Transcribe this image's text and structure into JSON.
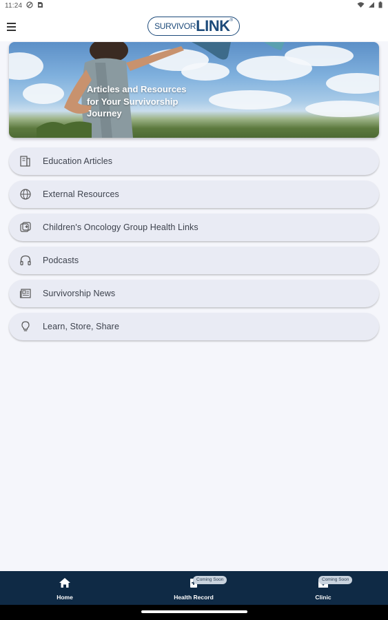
{
  "status_bar": {
    "time": "11:24",
    "left_icons": [
      "do-not-disturb-icon",
      "sim-card-icon"
    ],
    "right_icons": [
      "wifi-icon",
      "cell-signal-icon",
      "battery-icon"
    ]
  },
  "app_bar": {
    "menu_icon": "hamburger-menu-icon",
    "logo_text_small": "SURVIVOR",
    "logo_text_big": "LINK",
    "logo_tm": "®"
  },
  "hero": {
    "text": "Articles and Resources for Your Survivorship Journey"
  },
  "menu": {
    "items": [
      {
        "label": "Education Articles",
        "icon": "book-icon"
      },
      {
        "label": "External Resources",
        "icon": "globe-icon"
      },
      {
        "label": "Children's Oncology Group Health Links",
        "icon": "health-link-icon"
      },
      {
        "label": "Podcasts",
        "icon": "headphones-icon"
      },
      {
        "label": "Survivorship News",
        "icon": "newspaper-icon"
      },
      {
        "label": "Learn, Store, Share",
        "icon": "lightbulb-icon"
      }
    ]
  },
  "bottom_nav": {
    "items": [
      {
        "label": "Home",
        "icon": "home-icon",
        "badge": ""
      },
      {
        "label": "Health Record",
        "icon": "health-record-icon",
        "badge": "Coming Soon"
      },
      {
        "label": "Clinic",
        "icon": "clinic-icon",
        "badge": "Coming Soon"
      }
    ],
    "background_color": "#0f2a45"
  },
  "colors": {
    "accent": "#1c4a7a",
    "menu_item_bg": "#e9ebf4",
    "page_bg": "#f5f6fb"
  }
}
